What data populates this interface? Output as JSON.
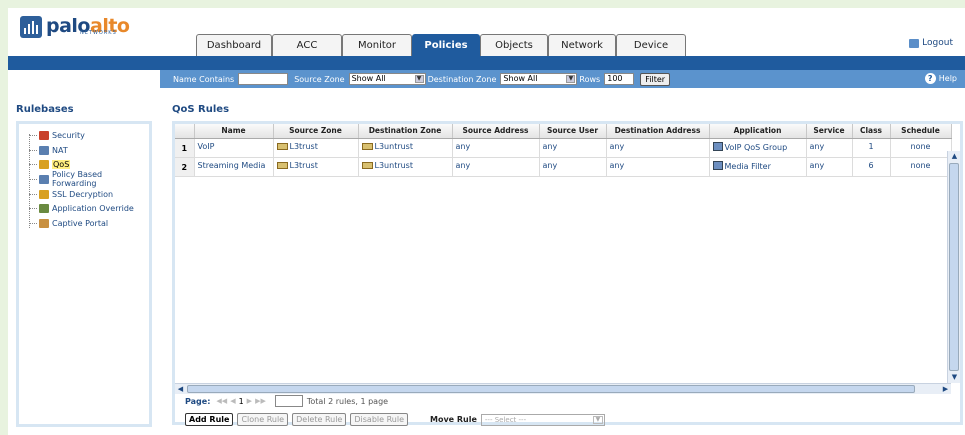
{
  "brand": {
    "name_main": "palo",
    "name_accent": "alto",
    "sub": "NETWORKS"
  },
  "tabs": [
    {
      "label": "Dashboard",
      "active": false
    },
    {
      "label": "ACC",
      "active": false
    },
    {
      "label": "Monitor",
      "active": false
    },
    {
      "label": "Policies",
      "active": true
    },
    {
      "label": "Objects",
      "active": false
    },
    {
      "label": "Network",
      "active": false
    },
    {
      "label": "Device",
      "active": false
    }
  ],
  "logout_label": "Logout",
  "filter": {
    "name_contains_label": "Name Contains",
    "name_contains_value": "",
    "source_zone_label": "Source Zone",
    "source_zone_value": "Show All",
    "destination_zone_label": "Destination Zone",
    "destination_zone_value": "Show All",
    "rows_label": "Rows",
    "rows_value": "100",
    "filter_button": "Filter",
    "help_label": "Help"
  },
  "rulebases": {
    "title": "Rulebases",
    "items": [
      {
        "label": "Security",
        "icon": "security-icon",
        "color": "#c8402a",
        "selected": false
      },
      {
        "label": "NAT",
        "icon": "nat-icon",
        "color": "#5a7fb0",
        "selected": false
      },
      {
        "label": "QoS",
        "icon": "qos-icon",
        "color": "#d8a020",
        "selected": true
      },
      {
        "label": "Policy Based Forwarding",
        "icon": "pbf-icon",
        "color": "#5a7fb0",
        "selected": false
      },
      {
        "label": "SSL Decryption",
        "icon": "ssl-icon",
        "color": "#d8a020",
        "selected": false
      },
      {
        "label": "Application Override",
        "icon": "app-override-icon",
        "color": "#6a8a40",
        "selected": false
      },
      {
        "label": "Captive Portal",
        "icon": "captive-portal-icon",
        "color": "#c89040",
        "selected": false
      }
    ]
  },
  "qos": {
    "title": "QoS Rules",
    "columns": [
      "",
      "Name",
      "Source Zone",
      "Destination Zone",
      "Source Address",
      "Source User",
      "Destination Address",
      "Application",
      "Service",
      "Class",
      "Schedule"
    ],
    "rows": [
      {
        "num": "1",
        "name": "VoIP",
        "source_zone": "L3trust",
        "destination_zone": "L3untrust",
        "source_address": "any",
        "source_user": "any",
        "destination_address": "any",
        "application": "VoIP QoS Group",
        "service": "any",
        "class": "1",
        "schedule": "none"
      },
      {
        "num": "2",
        "name": "Streaming Media",
        "source_zone": "L3trust",
        "destination_zone": "L3untrust",
        "source_address": "any",
        "source_user": "any",
        "destination_address": "any",
        "application": "Media Filter",
        "service": "any",
        "class": "6",
        "schedule": "none"
      }
    ]
  },
  "pager": {
    "label": "Page:",
    "page": "1",
    "summary": "Total 2 rules, 1 page"
  },
  "actions": {
    "add": "Add Rule",
    "clone": "Clone Rule",
    "delete": "Delete Rule",
    "disable": "Disable Rule",
    "move_label": "Move Rule",
    "move_placeholder": "--- Select ---"
  }
}
